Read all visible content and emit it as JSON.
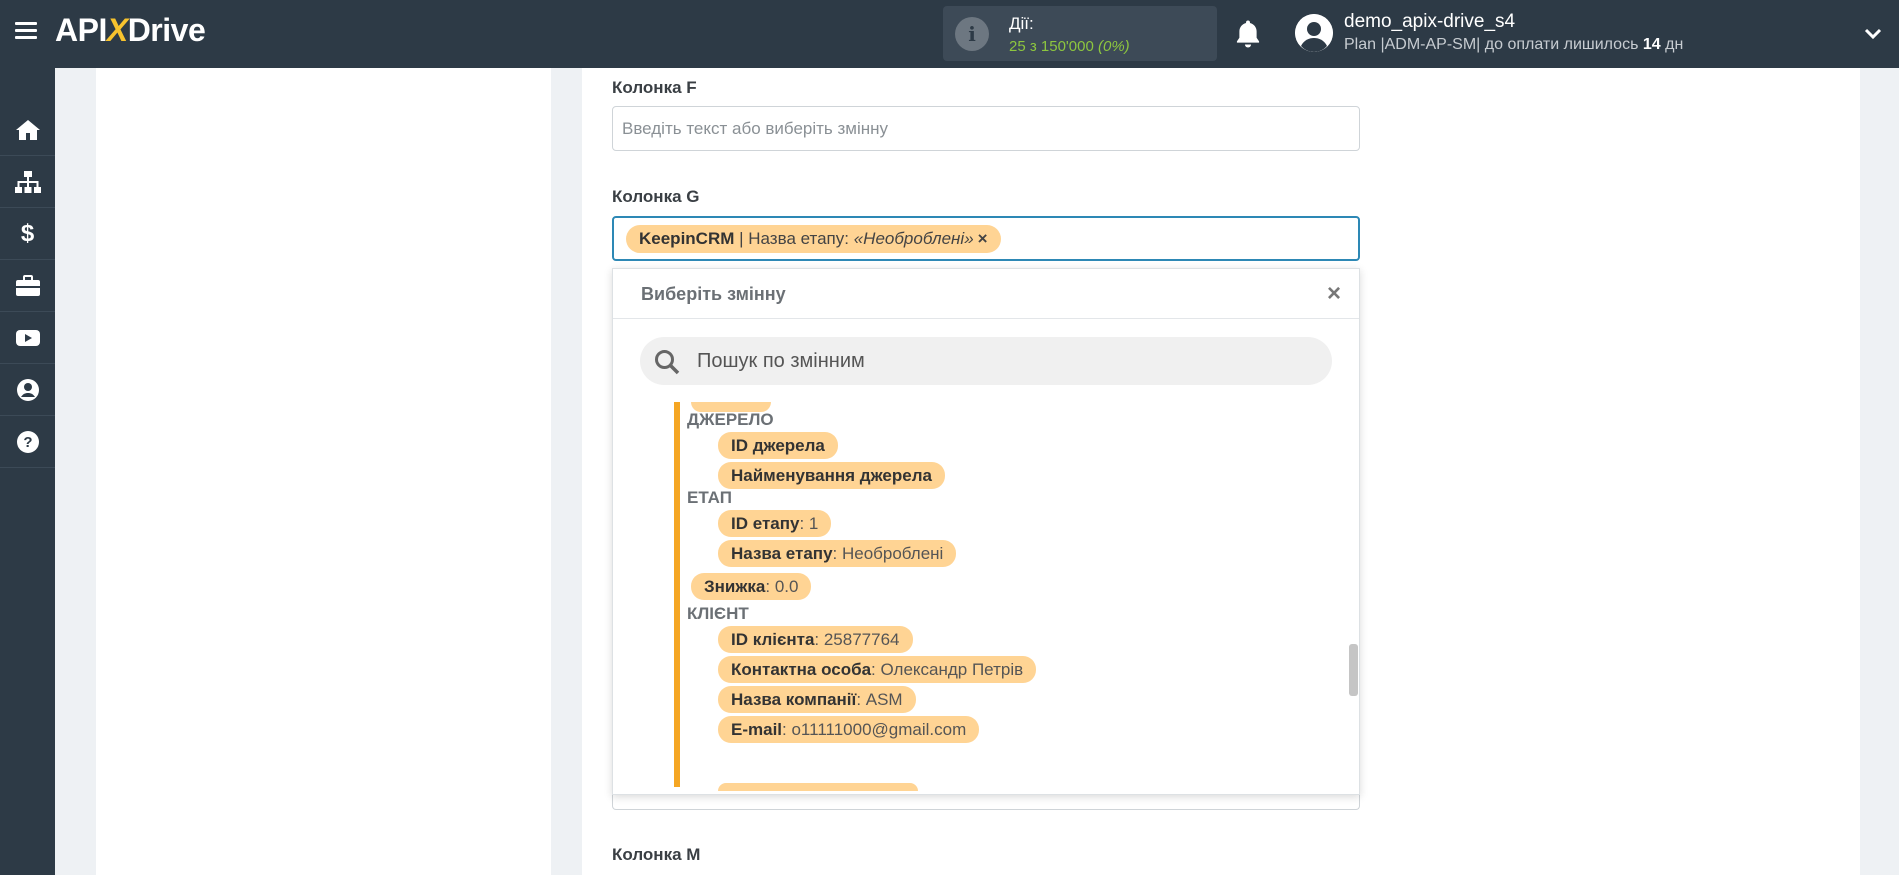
{
  "header": {
    "logo_api": "API",
    "logo_x": "X",
    "logo_drive": "Drive",
    "actions_label": "Дії:",
    "actions_count": "25 з 150'000",
    "actions_percent": "(0%)",
    "username": "demo_apix-drive_s4",
    "plan_prefix": "Plan |ADM-AP-SM| до оплати лишилось ",
    "plan_days": "14",
    "plan_suffix": " дн"
  },
  "sidebar": {
    "icons": [
      "home-icon",
      "sitemap-icon",
      "dollar-icon",
      "briefcase-icon",
      "youtube-icon",
      "user-icon",
      "help-icon"
    ]
  },
  "form": {
    "col_f_label": "Колонка F",
    "col_f_placeholder": "Введіть текст або виберіть змінну",
    "col_g_label": "Колонка G",
    "col_g_chip": {
      "source": "KeepinCRM",
      "sep": " | Назва етапу: ",
      "value": "«Необроблені»",
      "remove": "×"
    },
    "col_m_label": "Колонка M"
  },
  "dropdown": {
    "title": "Виберіть змінну",
    "close": "×",
    "search_placeholder": "Пошук по змінним",
    "groups": {
      "source": "ДЖЕРЕЛО",
      "stage": "ЕТАП",
      "client": "КЛІЄНТ"
    },
    "items": {
      "source_id": {
        "key": "ID джерела",
        "value": ""
      },
      "source_name": {
        "key": "Найменування джерела",
        "value": ""
      },
      "stage_id": {
        "key": "ID етапу",
        "value": ": 1"
      },
      "stage_name": {
        "key": "Назва етапу",
        "value": ": Необроблені"
      },
      "discount": {
        "key": "Знижка",
        "value": ": 0.0"
      },
      "client_id": {
        "key": "ID клієнта",
        "value": ": 25877764"
      },
      "contact": {
        "key": "Контактна особа",
        "value": ": Олександр Петрів"
      },
      "company": {
        "key": "Назва компанії",
        "value": ": ASM"
      },
      "email": {
        "key": "E-mail",
        "value": ": o11111000@gmail.com"
      }
    }
  },
  "colors": {
    "topbar": "#2d3a46",
    "chip": "#ffd494",
    "accent_bar": "#f5a623",
    "active_border": "#2d88b5",
    "actions_green": "#8dc63f"
  }
}
